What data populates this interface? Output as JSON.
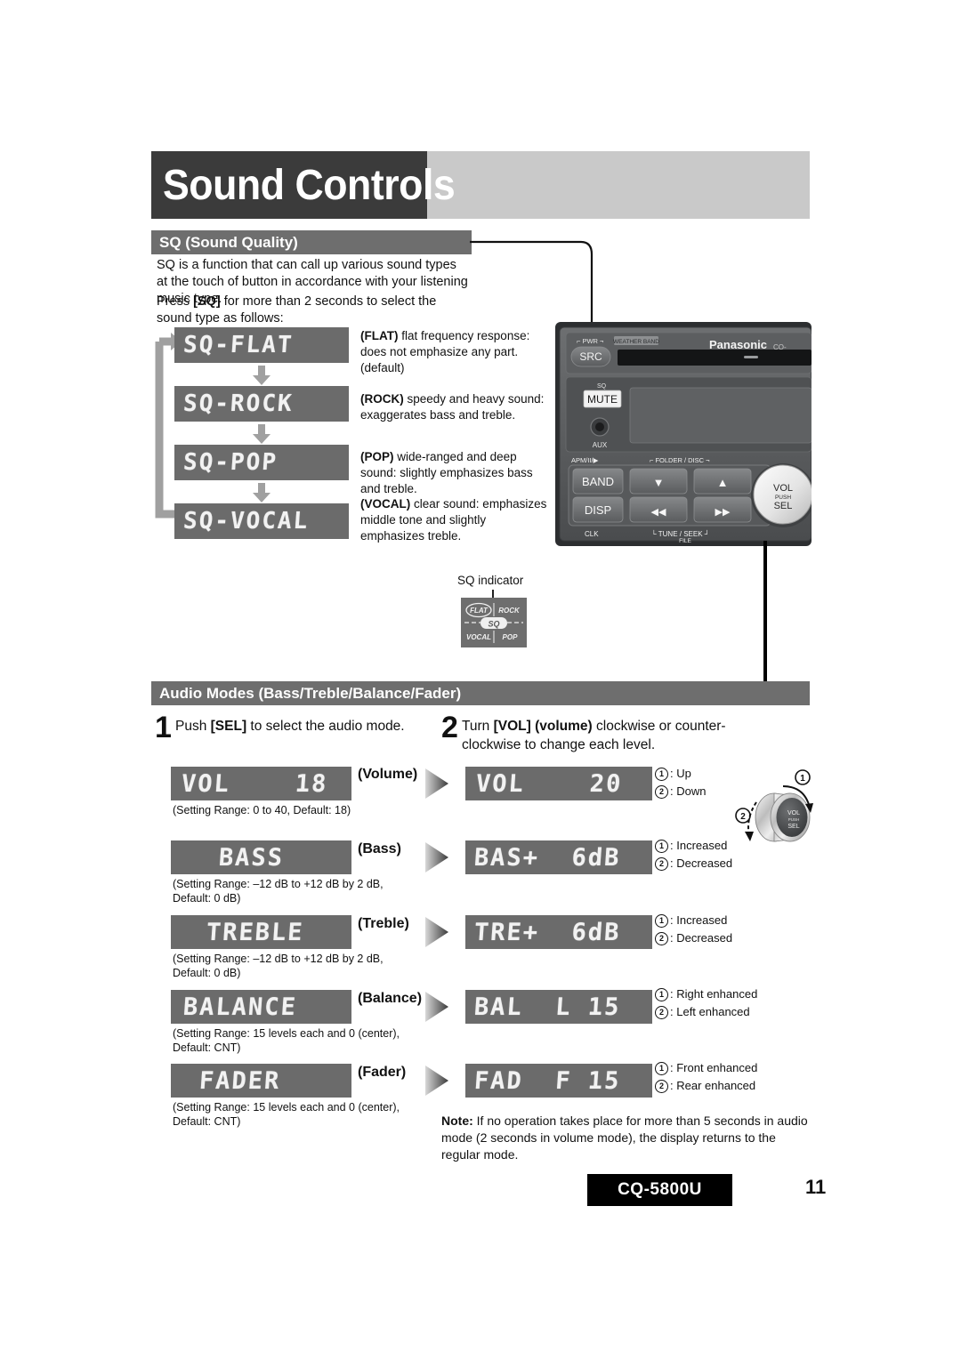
{
  "page": {
    "title": "Sound Controls",
    "model": "CQ-5800U",
    "number": "11"
  },
  "sq_section": {
    "heading": "SQ (Sound Quality)",
    "intro": "SQ is a function that can call up various sound types at the touch of button in accordance with your listening music type.",
    "instruction_pre": "Press ",
    "instruction_key": "[SQ]",
    "instruction_post": " for more than 2 seconds to select the sound type as follows:",
    "modes": [
      {
        "display": "SQ-FLAT",
        "name": "(FLAT)",
        "desc": "flat frequency response: does not emphasize any part. (default)"
      },
      {
        "display": "SQ-ROCK",
        "name": "(ROCK)",
        "desc": "speedy and heavy sound: exaggerates bass and treble."
      },
      {
        "display": "SQ-POP",
        "name": "(POP)",
        "desc": "wide-ranged and deep sound: slightly emphasizes bass and treble."
      },
      {
        "display": "SQ-VOCAL",
        "name": "(VOCAL)",
        "desc": "clear sound: emphasizes middle tone and slightly emphasizes treble."
      }
    ],
    "indicator_label": "SQ indicator",
    "indicator": {
      "flat": "FLAT",
      "rock": "ROCK",
      "badge": "SQ",
      "vocal": "VOCAL",
      "pop": "POP"
    }
  },
  "head_unit": {
    "brand": "Panasonic",
    "model_partial": "CQ-",
    "pwr_label": "PWR",
    "src_button": "SRC",
    "weather_band": "WEATHER BAND",
    "sq_label": "SQ",
    "mute_button": "MUTE",
    "aux_label": "AUX",
    "apm_label": "APM/II/▶",
    "folder_disc_label": "FOLDER / DISC",
    "band_button": "BAND",
    "disp_button": "DISP",
    "clk_label": "CLK",
    "tune_seek_label": "TUNE / SEEK",
    "file_label": "FILE",
    "knob_line1": "VOL",
    "knob_line2": "PUSH",
    "knob_line3": "SEL",
    "down_icon": "▼",
    "up_icon": "▲",
    "prev_icon": "◀◀",
    "next_icon": "▶▶"
  },
  "audio_section": {
    "heading": "Audio Modes (Bass/Treble/Balance/Fader)",
    "step1_num": "1",
    "step1_pre": "Push ",
    "step1_key": "[SEL]",
    "step1_post": " to select the audio mode.",
    "step2_num": "2",
    "step2_pre": "Turn ",
    "step2_key": "[VOL] (volume)",
    "step2_post": " clockwise or counter-clockwise to change each level.",
    "rows": [
      {
        "left_display": "VOL    18",
        "name": "(Volume)",
        "range": "(Setting Range: 0 to 40, Default: 18)",
        "right_display": "VOL    20",
        "cw_label": "Up",
        "ccw_label": "Down"
      },
      {
        "left_display": "BASS",
        "name": "(Bass)",
        "range": "(Setting Range: –12 dB to +12 dB by 2 dB, Default: 0 dB)",
        "right_display": "BAS+  6dB",
        "cw_label": "Increased",
        "ccw_label": "Decreased"
      },
      {
        "left_display": "TREBLE",
        "name": "(Treble)",
        "range": "(Setting Range: –12 dB to +12 dB by 2 dB, Default: 0 dB)",
        "right_display": "TRE+  6dB",
        "cw_label": "Increased",
        "ccw_label": "Decreased"
      },
      {
        "left_display": "BALANCE",
        "name": "(Balance)",
        "range": "(Setting Range: 15 levels each and 0 (center), Default: CNT)",
        "right_display": "BAL  L 15",
        "cw_label": "Right enhanced",
        "ccw_label": "Left enhanced"
      },
      {
        "left_display": "FADER",
        "name": "(Fader)",
        "range": "(Setting Range: 15 levels each and 0 (center), Default: CNT)",
        "right_display": "FAD  F 15",
        "cw_label": "Front enhanced",
        "ccw_label": "Rear enhanced"
      }
    ],
    "knob": {
      "cw_marker": "1",
      "ccw_marker": "2",
      "line1": "VOL",
      "line2": "PUSH",
      "line3": "SEL"
    },
    "note_label": "Note:",
    "note_text": " If no operation takes place for more than 5 seconds in audio mode (2 seconds in volume mode), the display returns to the regular mode."
  },
  "colors": {
    "title_box": "#3b3b3b",
    "title_bar": "#c9c9c9",
    "section_header": "#6e6e6e",
    "lcd_bg": "#6b6b6b",
    "lcd_text": "#f2f2f2",
    "model_badge": "#000000"
  }
}
